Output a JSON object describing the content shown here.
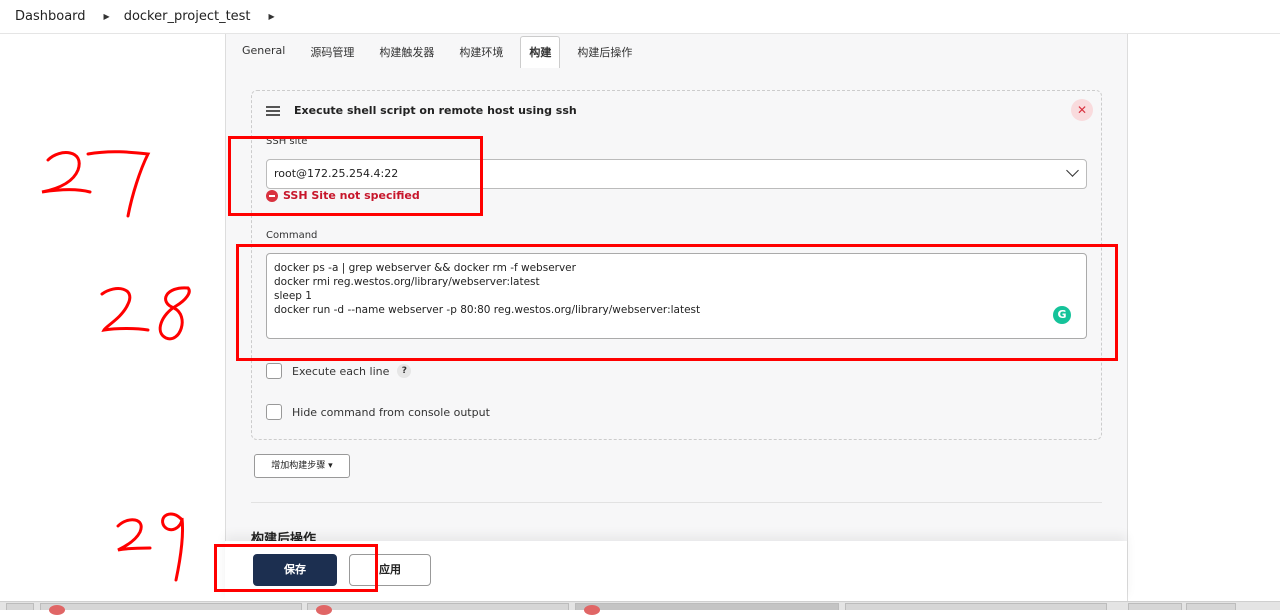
{
  "breadcrumb": {
    "items": [
      "Dashboard",
      "docker_project_test"
    ]
  },
  "tabs": [
    {
      "label": "General",
      "active": false
    },
    {
      "label": "源码管理",
      "active": false
    },
    {
      "label": "构建触发器",
      "active": false
    },
    {
      "label": "构建环境",
      "active": false
    },
    {
      "label": "构建",
      "active": true
    },
    {
      "label": "构建后操作",
      "active": false
    }
  ],
  "step": {
    "title": "Execute shell script on remote host using ssh",
    "ssh_site_label": "SSH site",
    "ssh_site_value": "root@172.25.254.4:22",
    "ssh_error": "SSH Site not specified",
    "command_label": "Command",
    "command_text": "docker ps -a | grep webserver && docker rm -f webserver\ndocker rmi reg.westos.org/library/webserver:latest\nsleep 1\ndocker run -d --name webserver -p 80:80 reg.westos.org/library/webserver:latest",
    "execute_each_line_label": "Execute each line",
    "hide_command_label": "Hide command from console output",
    "help_glyph": "?",
    "grammarly_glyph": "G"
  },
  "add_step_label": "增加构建步骤",
  "post_build_title": "构建后操作",
  "buttons": {
    "save": "保存",
    "apply": "应用"
  },
  "annotations": [
    "27",
    "28",
    "29"
  ],
  "colors": {
    "annotation": "#ff0000",
    "save_button": "#1c2f50",
    "error": "#c7162b",
    "close_button_bg": "#f9dbdd"
  }
}
